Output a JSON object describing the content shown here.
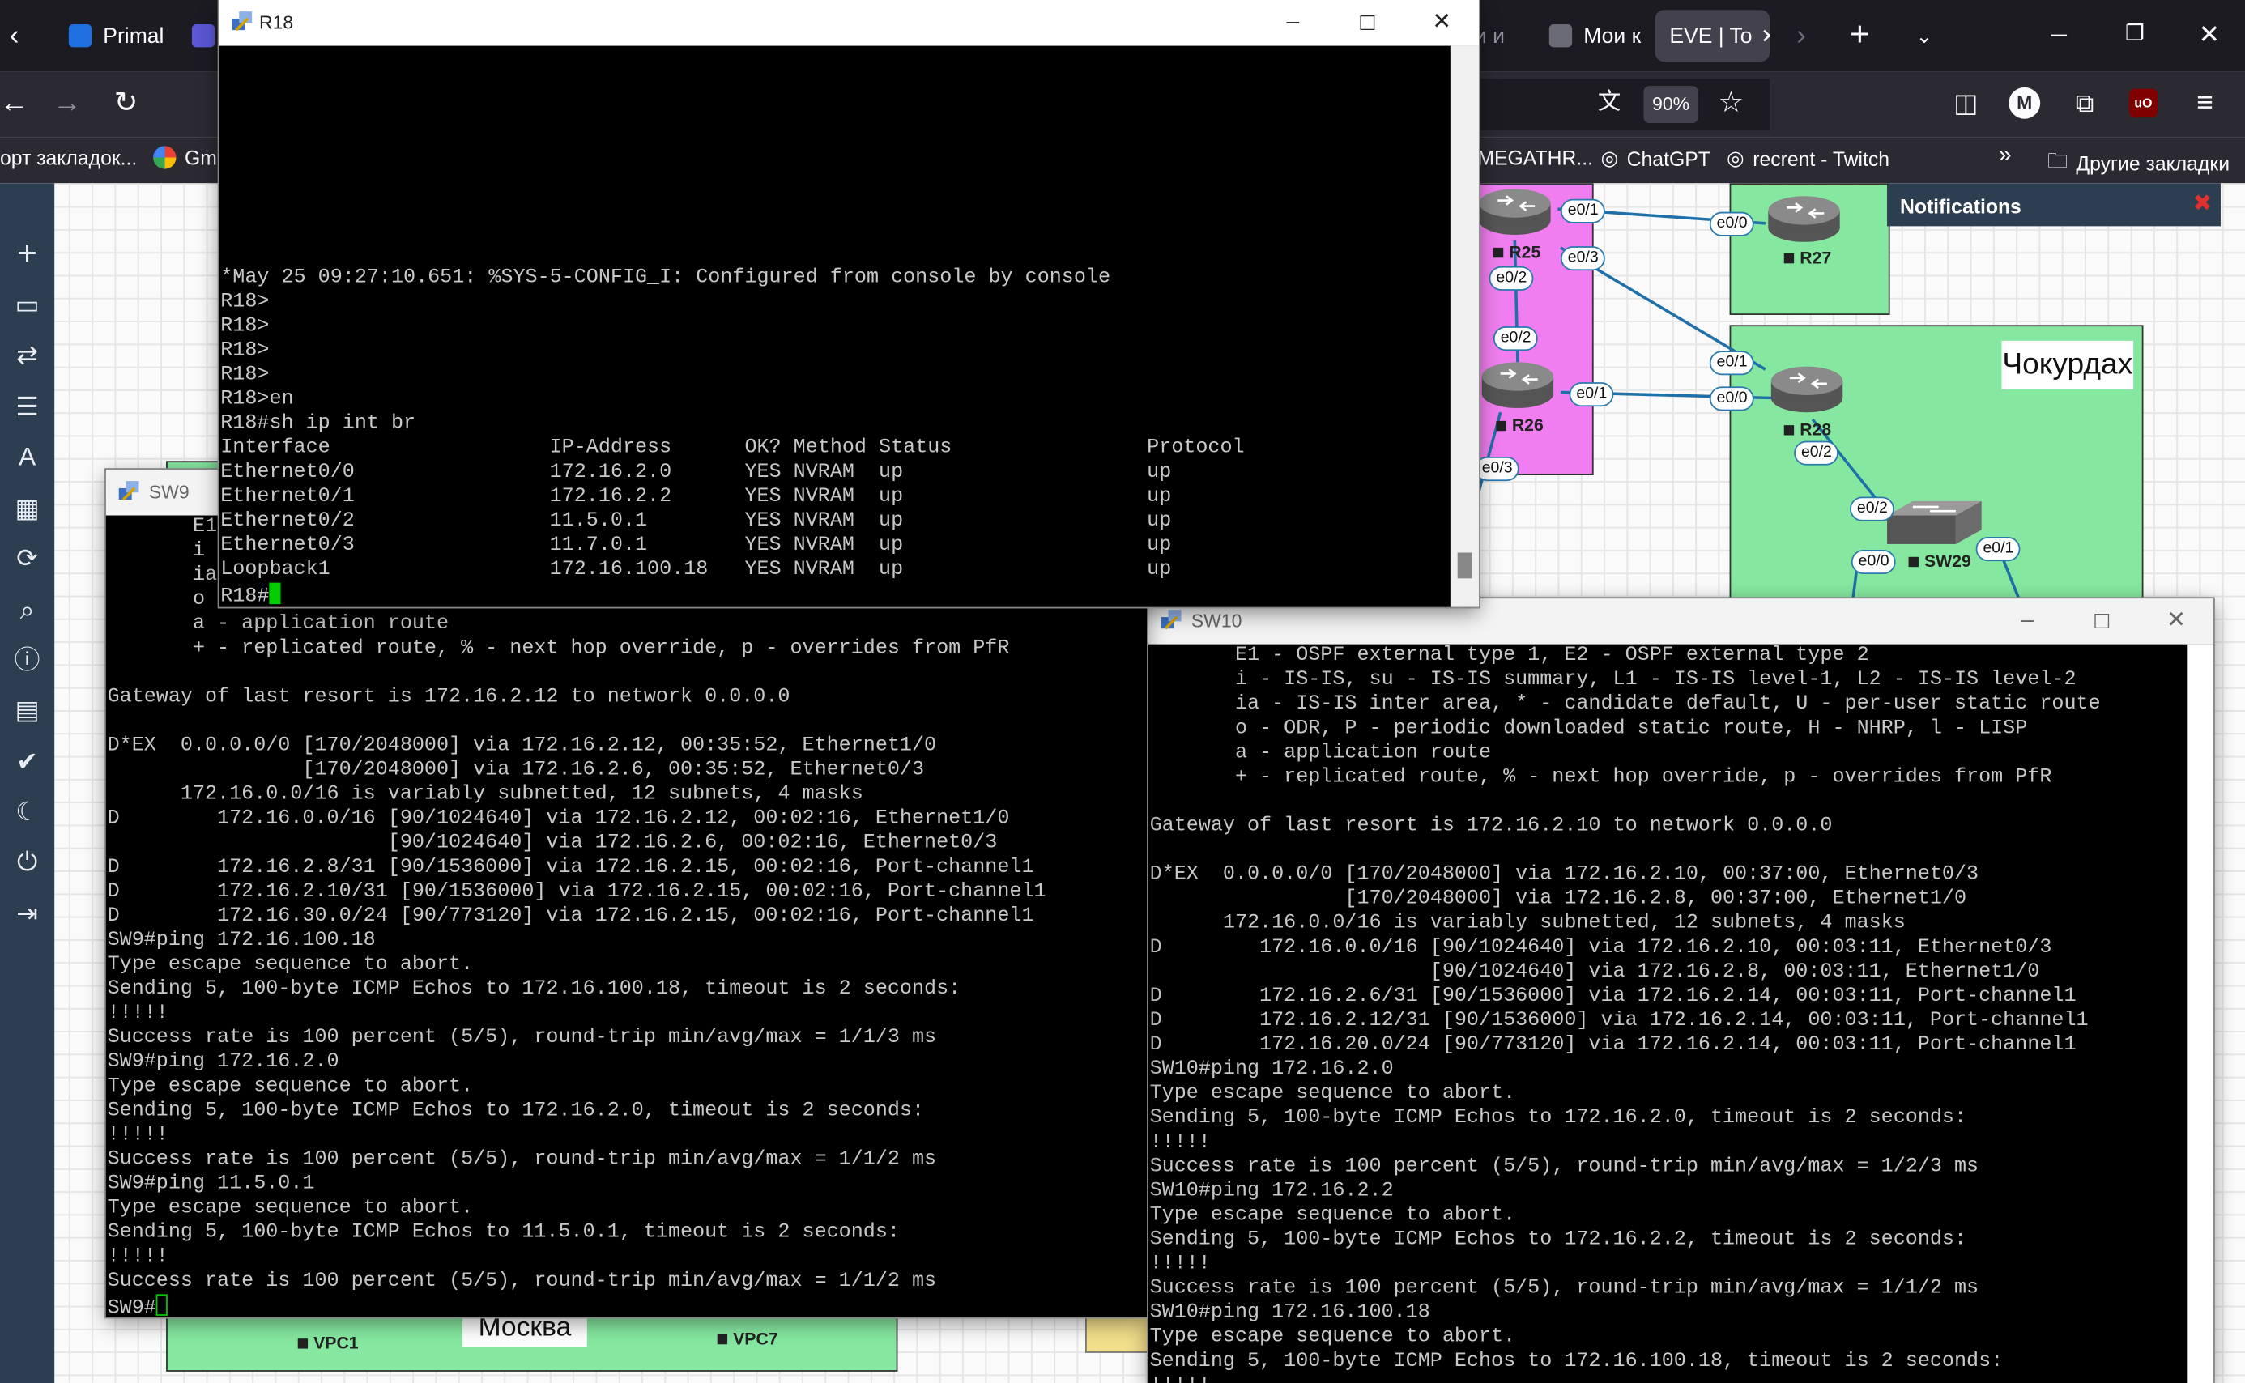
{
  "browser": {
    "tabs": [
      {
        "label": "Primal"
      },
      {
        "label": "и и"
      },
      {
        "label": "Мои к"
      },
      {
        "label": "EVE | To"
      }
    ],
    "zoom": "90%",
    "bookmarks": [
      {
        "label": "орт закладок..."
      },
      {
        "label": "Gm"
      },
      {
        "label": "MEGATHR..."
      },
      {
        "label": "ChatGPT"
      },
      {
        "label": "recrent - Twitch"
      },
      {
        "label": "Другие закладки"
      }
    ],
    "colors": {
      "tabbar": "#1c1b22",
      "toolbar": "#2b2a33",
      "active_tab": "#42414d"
    }
  },
  "topology": {
    "notifications_title": "Notifications",
    "labels": {
      "chokurdakh": "Чокурдах",
      "moscow": "Москва"
    },
    "nodes": [
      {
        "name": "R25"
      },
      {
        "name": "R26"
      },
      {
        "name": "R27"
      },
      {
        "name": "R28"
      },
      {
        "name": "SW29"
      },
      {
        "name": "VPC1"
      },
      {
        "name": "VPC7"
      }
    ],
    "ports": [
      "e0/1",
      "e0/3",
      "e0/2",
      "e0/2",
      "e0/1",
      "e0/3",
      "e0/0",
      "e0/1",
      "e0/0",
      "e0/2",
      "e0/2",
      "e0/0",
      "e0/1"
    ],
    "colors": {
      "pink_area": "#f07ef0",
      "green_area": "#86e8a0",
      "link": "#1f6fa8"
    }
  },
  "windows": {
    "r18": {
      "title": "R18",
      "lines": [
        "",
        "",
        "",
        "",
        "",
        "",
        "",
        "",
        "",
        "*May 25 09:27:10.651: %SYS-5-CONFIG_I: Configured from console by console",
        "R18>",
        "R18>",
        "R18>",
        "R18>",
        "R18>en",
        "R18#sh ip int br",
        "Interface                  IP-Address      OK? Method Status                Protocol",
        "Ethernet0/0                172.16.2.0      YES NVRAM  up                    up",
        "Ethernet0/1                172.16.2.2      YES NVRAM  up                    up",
        "Ethernet0/2                11.5.0.1        YES NVRAM  up                    up",
        "Ethernet0/3                11.7.0.1        YES NVRAM  up                    up",
        "Loopback1                  172.16.100.18   YES NVRAM  up                    up"
      ],
      "prompt": "R18#"
    },
    "sw9": {
      "title": "SW9",
      "lines": [
        "       E1",
        "       i",
        "       ia",
        "       o",
        "       a - application route",
        "       + - replicated route, % - next hop override, p - overrides from PfR",
        "",
        "Gateway of last resort is 172.16.2.12 to network 0.0.0.0",
        "",
        "D*EX  0.0.0.0/0 [170/2048000] via 172.16.2.12, 00:35:52, Ethernet1/0",
        "                [170/2048000] via 172.16.2.6, 00:35:52, Ethernet0/3",
        "      172.16.0.0/16 is variably subnetted, 12 subnets, 4 masks",
        "D        172.16.0.0/16 [90/1024640] via 172.16.2.12, 00:02:16, Ethernet1/0",
        "                       [90/1024640] via 172.16.2.6, 00:02:16, Ethernet0/3",
        "D        172.16.2.8/31 [90/1536000] via 172.16.2.15, 00:02:16, Port-channel1",
        "D        172.16.2.10/31 [90/1536000] via 172.16.2.15, 00:02:16, Port-channel1",
        "D        172.16.30.0/24 [90/773120] via 172.16.2.15, 00:02:16, Port-channel1",
        "SW9#ping 172.16.100.18",
        "Type escape sequence to abort.",
        "Sending 5, 100-byte ICMP Echos to 172.16.100.18, timeout is 2 seconds:",
        "!!!!!",
        "Success rate is 100 percent (5/5), round-trip min/avg/max = 1/1/3 ms",
        "SW9#ping 172.16.2.0",
        "Type escape sequence to abort.",
        "Sending 5, 100-byte ICMP Echos to 172.16.2.0, timeout is 2 seconds:",
        "!!!!!",
        "Success rate is 100 percent (5/5), round-trip min/avg/max = 1/1/2 ms",
        "SW9#ping 11.5.0.1",
        "Type escape sequence to abort.",
        "Sending 5, 100-byte ICMP Echos to 11.5.0.1, timeout is 2 seconds:",
        "!!!!!",
        "Success rate is 100 percent (5/5), round-trip min/avg/max = 1/1/2 ms"
      ],
      "prompt": "SW9#"
    },
    "sw10": {
      "title": "SW10",
      "lines": [
        "       E1 - OSPF external type 1, E2 - OSPF external type 2",
        "       i - IS-IS, su - IS-IS summary, L1 - IS-IS level-1, L2 - IS-IS level-2",
        "       ia - IS-IS inter area, * - candidate default, U - per-user static route",
        "       o - ODR, P - periodic downloaded static route, H - NHRP, l - LISP",
        "       a - application route",
        "       + - replicated route, % - next hop override, p - overrides from PfR",
        "",
        "Gateway of last resort is 172.16.2.10 to network 0.0.0.0",
        "",
        "D*EX  0.0.0.0/0 [170/2048000] via 172.16.2.10, 00:37:00, Ethernet0/3",
        "                [170/2048000] via 172.16.2.8, 00:37:00, Ethernet1/0",
        "      172.16.0.0/16 is variably subnetted, 12 subnets, 4 masks",
        "D        172.16.0.0/16 [90/1024640] via 172.16.2.10, 00:03:11, Ethernet0/3",
        "                       [90/1024640] via 172.16.2.8, 00:03:11, Ethernet1/0",
        "D        172.16.2.6/31 [90/1536000] via 172.16.2.14, 00:03:11, Port-channel1",
        "D        172.16.2.12/31 [90/1536000] via 172.16.2.14, 00:03:11, Port-channel1",
        "D        172.16.20.0/24 [90/773120] via 172.16.2.14, 00:03:11, Port-channel1",
        "SW10#ping 172.16.2.0",
        "Type escape sequence to abort.",
        "Sending 5, 100-byte ICMP Echos to 172.16.2.0, timeout is 2 seconds:",
        "!!!!!",
        "Success rate is 100 percent (5/5), round-trip min/avg/max = 1/2/3 ms",
        "SW10#ping 172.16.2.2",
        "Type escape sequence to abort.",
        "Sending 5, 100-byte ICMP Echos to 172.16.2.2, timeout is 2 seconds:",
        "!!!!!",
        "Success rate is 100 percent (5/5), round-trip min/avg/max = 1/1/2 ms",
        "SW10#ping 172.16.100.18",
        "Type escape sequence to abort.",
        "Sending 5, 100-byte ICMP Echos to 172.16.100.18, timeout is 2 seconds:",
        "!!!!!"
      ]
    }
  }
}
